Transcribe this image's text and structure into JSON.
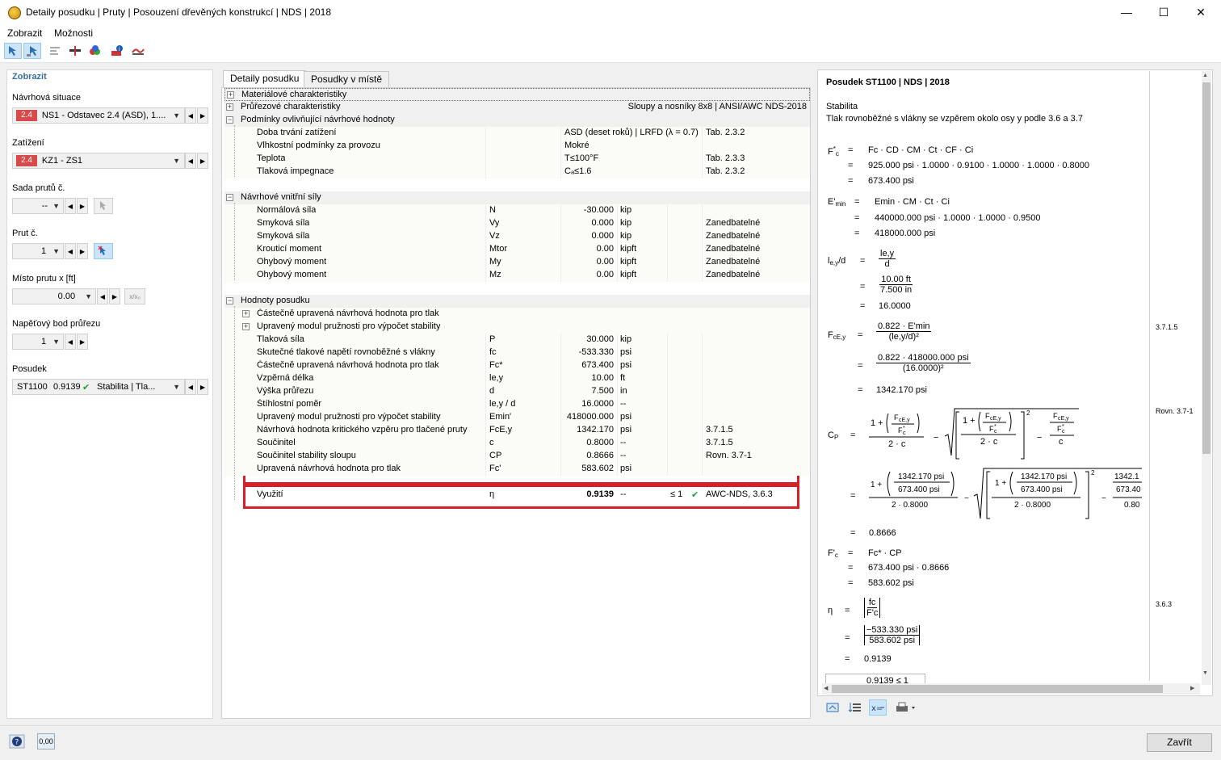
{
  "window": {
    "title": "Detaily posudku | Pruty | Posouzení dřevěných konstrukcí | NDS | 2018",
    "minimize": "—",
    "maximize": "☐",
    "close": "✕"
  },
  "menu": [
    "Zobrazit",
    "Možnosti"
  ],
  "left": {
    "heading": "Zobrazit",
    "design_situation_label": "Návrhová situace",
    "design_situation_badge": "2.4",
    "design_situation_value": "NS1 - Odstavec 2.4 (ASD), 1....",
    "load_label": "Zatížení",
    "load_badge": "2.4",
    "load_value": "KZ1 - ZS1",
    "member_set_label": "Sada prutů č.",
    "member_set_value": "--",
    "member_label": "Prut č.",
    "member_value": "1",
    "location_label": "Místo prutu x [ft]",
    "location_value": "0.00",
    "location_btn": "x/x₀",
    "stress_point_label": "Napěťový bod průřezu",
    "stress_point_value": "1",
    "check_label": "Posudek",
    "check_id": "ST1100",
    "check_ratio": "0.9139",
    "check_type": "Stabilita | Tla..."
  },
  "tabs": [
    "Detaily posudku",
    "Posudky v místě"
  ],
  "table": {
    "material": "Materiálové charakteristiky",
    "section": "Průřezové charakteristiky",
    "section_info": "Sloupy a nosníky 8x8 | ANSI/AWC NDS-2018",
    "conditions": "Podmínky ovlivňující návrhové hodnoty",
    "cond_rows": [
      {
        "name": "Doba trvání zatížení",
        "value": "ASD (deset roků) | LRFD (λ = 0.7)",
        "ref": "Tab. 2.3.2"
      },
      {
        "name": "Vlhkostní podmínky za provozu",
        "value": "Mokré",
        "ref": ""
      },
      {
        "name": "Teplota",
        "value": "T≤100°F",
        "ref": "Tab. 2.3.3"
      },
      {
        "name": "Tlaková impegnace",
        "value": "Cₐ≤1.6",
        "ref": "Tab. 2.3.2"
      }
    ],
    "forces": "Návrhové vnitřní síly",
    "force_rows": [
      {
        "name": "Normálová síla",
        "sym": "N",
        "val": "-30.000",
        "unit": "kip",
        "note": ""
      },
      {
        "name": "Smyková síla",
        "sym": "Vy",
        "val": "0.000",
        "unit": "kip",
        "note": "Zanedbatelné"
      },
      {
        "name": "Smyková síla",
        "sym": "Vz",
        "val": "0.000",
        "unit": "kip",
        "note": "Zanedbatelné"
      },
      {
        "name": "Krouticí moment",
        "sym": "Mtor",
        "val": "0.00",
        "unit": "kipft",
        "note": "Zanedbatelné"
      },
      {
        "name": "Ohybový moment",
        "sym": "My",
        "val": "0.00",
        "unit": "kipft",
        "note": "Zanedbatelné"
      },
      {
        "name": "Ohybový moment",
        "sym": "Mz",
        "val": "0.00",
        "unit": "kipft",
        "note": "Zanedbatelné"
      }
    ],
    "values": "Hodnoty posudku",
    "sub_groups": [
      "Částečně upravená návrhová hodnota pro tlak",
      "Upravený modul pružnosti pro výpočet stability"
    ],
    "value_rows": [
      {
        "name": "Tlaková síla",
        "sym": "P",
        "val": "30.000",
        "unit": "kip",
        "ref": ""
      },
      {
        "name": "Skutečné tlakové napětí rovnoběžné s vlákny",
        "sym": "fc",
        "val": "-533.330",
        "unit": "psi",
        "ref": ""
      },
      {
        "name": "Částečně upravená návrhová hodnota pro tlak",
        "sym": "Fc*",
        "val": "673.400",
        "unit": "psi",
        "ref": ""
      },
      {
        "name": "Vzpěrná délka",
        "sym": "le,y",
        "val": "10.00",
        "unit": "ft",
        "ref": ""
      },
      {
        "name": "Výška průřezu",
        "sym": "d",
        "val": "7.500",
        "unit": "in",
        "ref": ""
      },
      {
        "name": "Štíhlostní poměr",
        "sym": "le,y / d",
        "val": "16.0000",
        "unit": "--",
        "ref": ""
      },
      {
        "name": "Upravený modul pružnosti pro výpočet stability",
        "sym": "Emin'",
        "val": "418000.000",
        "unit": "psi",
        "ref": ""
      },
      {
        "name": "Návrhová hodnota kritického vzpěru pro tlačené pruty",
        "sym": "FcE,y",
        "val": "1342.170",
        "unit": "psi",
        "ref": "3.7.1.5"
      },
      {
        "name": "Součinitel",
        "sym": "c",
        "val": "0.8000",
        "unit": "--",
        "ref": "3.7.1.5"
      },
      {
        "name": "Součinitel stability sloupu",
        "sym": "CP",
        "val": "0.8666",
        "unit": "--",
        "ref": "Rovn. 3.7-1"
      },
      {
        "name": "Upravená návrhová hodnota pro tlak",
        "sym": "Fc'",
        "val": "583.602",
        "unit": "psi",
        "ref": ""
      }
    ],
    "ratio_row": {
      "name": "Využití",
      "sym": "η",
      "val": "0.9139",
      "unit": "--",
      "cond": "≤ 1",
      "ref": "AWC-NDS, 3.6.3"
    }
  },
  "right": {
    "title": "Posudek ST1100 | NDS | 2018",
    "section": "Stabilita",
    "desc": "Tlak rovnoběžné s vlákny se vzpěrem okolo osy y podle 3.6 a 3.7",
    "eq1_line1": "Fc  ·  CD  ·  CM  ·  Ct  ·  CF  ·  Ci",
    "eq1_line2": "925.000 psi  ·  1.0000  ·  0.9100  ·  1.0000  ·  1.0000  ·  0.8000",
    "eq1_line3": "673.400 psi",
    "eq2_line1": "Emin  ·  CM  ·  Ct  ·  Ci",
    "eq2_line2": "440000.000 psi  ·  1.0000  ·  1.0000  ·  0.9500",
    "eq2_line3": "418000.000 psi",
    "eq3_num1": "le,y",
    "eq3_den1": "d",
    "eq3_num2": "10.00 ft",
    "eq3_den2": "7.500 in",
    "eq3_result": "16.0000",
    "eq4_num1": "0.822  ·  E'min",
    "eq4_den1": "(le,y/d)²",
    "eq4_num2": "0.822  ·  418000.000 psi",
    "eq4_den2": "(16.0000)²",
    "eq4_result": "1342.170 psi",
    "eq4_ref": "3.7.1.5",
    "eq5_ref": "Rovn. 3.7-1",
    "eq5_n1": "1342.170 psi",
    "eq5_d1": "673.400 psi",
    "eq5_c": "2  ·  0.8000",
    "eq5_cut": "1342.1",
    "eq5_cut2": "673.40",
    "eq5_cut3": "0.80",
    "eq5_result": "0.8666",
    "eq6_line1": "Fc*  ·  CP",
    "eq6_line2": "673.400 psi  ·  0.8666",
    "eq6_line3": "583.602 psi",
    "eq7_num1": "fc",
    "eq7_den1": "F'c",
    "eq7_num2": "−533.330 psi",
    "eq7_den2": "583.602 psi",
    "eq7_result": "0.9139",
    "eq7_ref": "3.6.3",
    "eq8_partial": "0.9139  ≤  1"
  },
  "bottom": {
    "close": "Zavřít",
    "units_icon": "0,00"
  }
}
